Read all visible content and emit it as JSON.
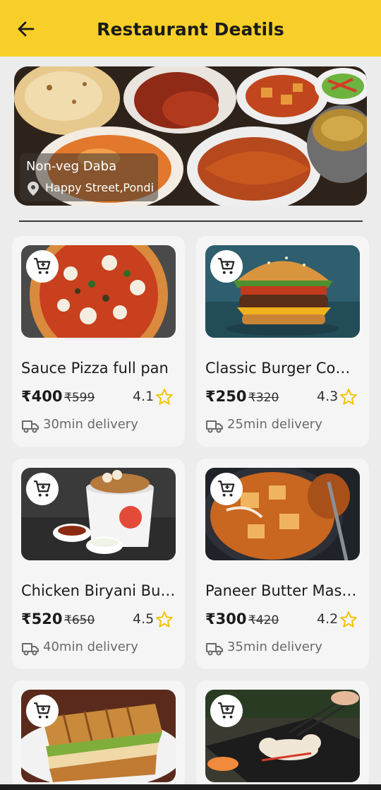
{
  "header": {
    "title": "Restaurant Deatils",
    "back_icon": "arrow-left-icon",
    "color": "#f8cf28"
  },
  "restaurant": {
    "name": "Non-veg Daba",
    "location": "Happy Street,Pondi",
    "location_icon": "map-pin-icon"
  },
  "items": [
    {
      "name": "Sauce Pizza full pan",
      "price": "₹400",
      "old_price": "₹599",
      "rating": "4.1",
      "delivery": "30min delivery"
    },
    {
      "name": "Classic Burger Combo",
      "price": "₹250",
      "old_price": "₹320",
      "rating": "4.3",
      "delivery": "25min delivery"
    },
    {
      "name": "Chicken Biryani Bucket",
      "price": "₹520",
      "old_price": "₹650",
      "rating": "4.5",
      "delivery": "40min delivery"
    },
    {
      "name": "Paneer Butter Masala",
      "price": "₹300",
      "old_price": "₹420",
      "rating": "4.2",
      "delivery": "35min delivery"
    },
    {
      "name": "",
      "price": "",
      "old_price": "",
      "rating": "",
      "delivery": ""
    },
    {
      "name": "",
      "price": "",
      "old_price": "",
      "rating": "",
      "delivery": ""
    }
  ],
  "icons": {
    "cart": "cart-icon",
    "star": "star-outline-icon",
    "truck": "truck-icon"
  },
  "colors": {
    "accent": "#f8cf28",
    "star": "#f2c200",
    "card_bg": "#f5f5f5",
    "page_bg": "#ececec"
  }
}
